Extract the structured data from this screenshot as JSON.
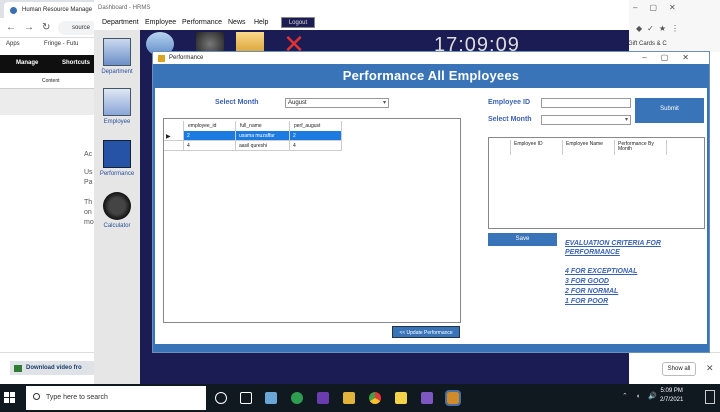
{
  "browser": {
    "tab_title": "Human Resource Manage",
    "address": "source",
    "bookmarks": [
      "Apps",
      "Fringe - Futu"
    ],
    "drupal_toolbar": [
      "Manage",
      "Shortcuts"
    ],
    "drupal_sub": "Content",
    "left_text_fragments": [
      "Ac",
      "Us",
      "Pa",
      "Th",
      "on",
      "mo"
    ],
    "right_bookmark": "Gift Cards & C",
    "download_item": "Download video fro",
    "show_all": "Show all"
  },
  "hrms": {
    "title": "Dashboard - HRMS",
    "menu": [
      "Department",
      "Employee",
      "Performance",
      "News",
      "Help"
    ],
    "logout": "Logout",
    "clock": "17:09:09",
    "sidebar": [
      "Department",
      "Employee",
      "Performance",
      "Calculator"
    ]
  },
  "performance": {
    "window_title": "Performance",
    "heading": "Performance All Employees",
    "select_month_label": "Select Month",
    "select_month_value": "August",
    "employee_id_label": "Employee ID",
    "employee_id_value": "",
    "select_month2_label": "Select Month",
    "select_month2_value": "",
    "submit_label": "Submit",
    "left_grid": {
      "columns": [
        "employee_id",
        "full_name",
        "perf_august"
      ],
      "rows": [
        [
          "2",
          "usama muzaffar",
          "2"
        ],
        [
          "4",
          "aasil qureshi",
          "4"
        ]
      ]
    },
    "right_grid": {
      "columns": [
        "Employee ID",
        "Employee Name",
        "Performance By Month"
      ]
    },
    "save_label": "Save",
    "update_label": "<< Update Performance",
    "criteria_title": "EVALUATION CRITERIA FOR PERFORMANCE",
    "criteria": [
      "4 FOR EXCEPTIONAL",
      "3 FOR GOOD",
      "2 FOR NORMAL",
      "1 FOR POOR"
    ]
  },
  "taskbar": {
    "search_placeholder": "Type here to search",
    "time": "5:09 PM",
    "date": "2/7/2021"
  }
}
